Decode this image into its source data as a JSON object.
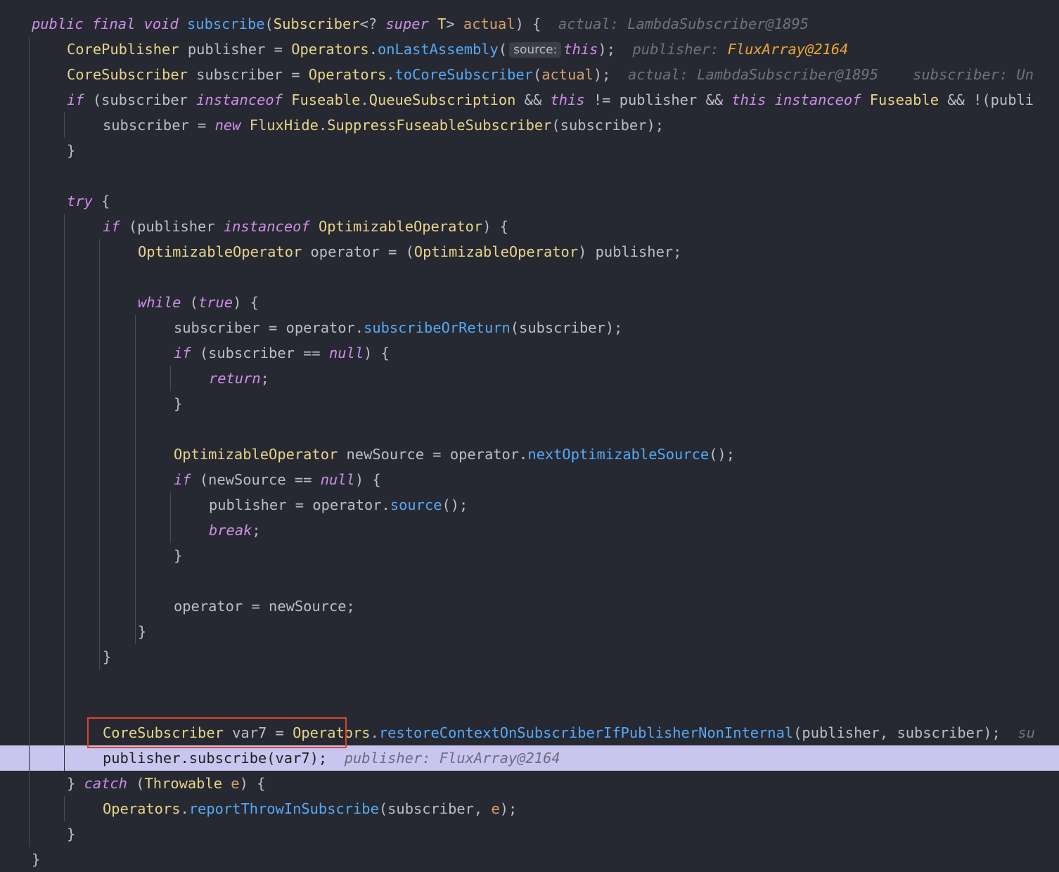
{
  "editor": {
    "highlight_line": 29,
    "lines": [
      {
        "tokens": [
          {
            "t": "public",
            "k": "kw"
          },
          {
            "t": " ",
            "k": "plain"
          },
          {
            "t": "final",
            "k": "kw"
          },
          {
            "t": " ",
            "k": "plain"
          },
          {
            "t": "void",
            "k": "kw"
          },
          {
            "t": " ",
            "k": "plain"
          },
          {
            "t": "subscribe",
            "k": "method"
          },
          {
            "t": "(",
            "k": "plain"
          },
          {
            "t": "Subscriber",
            "k": "type"
          },
          {
            "t": "<? ",
            "k": "plain"
          },
          {
            "t": "super",
            "k": "kw"
          },
          {
            "t": " ",
            "k": "plain"
          },
          {
            "t": "T",
            "k": "type"
          },
          {
            "t": "> ",
            "k": "plain"
          },
          {
            "t": "actual",
            "k": "param"
          },
          {
            "t": ") {  ",
            "k": "plain"
          },
          {
            "t": "actual: LambdaSubscriber@1895",
            "k": "hint"
          }
        ]
      },
      {
        "tokens": [
          {
            "t": "CorePublisher",
            "k": "type"
          },
          {
            "t": " publisher = ",
            "k": "plain"
          },
          {
            "t": "Operators",
            "k": "type"
          },
          {
            "t": ".",
            "k": "plain"
          },
          {
            "t": "onLastAssembly",
            "k": "method"
          },
          {
            "t": "(",
            "k": "plain"
          },
          {
            "t": "source:",
            "k": "paramhint"
          },
          {
            "t": "this",
            "k": "kw"
          },
          {
            "t": ");  ",
            "k": "plain"
          },
          {
            "t": "publisher: ",
            "k": "hint"
          },
          {
            "t": "FluxArray@2164",
            "k": "hintval"
          }
        ]
      },
      {
        "tokens": [
          {
            "t": "CoreSubscriber",
            "k": "type"
          },
          {
            "t": " subscriber = ",
            "k": "plain"
          },
          {
            "t": "Operators",
            "k": "type"
          },
          {
            "t": ".",
            "k": "plain"
          },
          {
            "t": "toCoreSubscriber",
            "k": "method"
          },
          {
            "t": "(",
            "k": "plain"
          },
          {
            "t": "actual",
            "k": "param"
          },
          {
            "t": ");  ",
            "k": "plain"
          },
          {
            "t": "actual: LambdaSubscriber@1895    subscriber: Un",
            "k": "hint"
          }
        ]
      },
      {
        "tokens": [
          {
            "t": "if",
            "k": "kw"
          },
          {
            "t": " (subscriber ",
            "k": "plain"
          },
          {
            "t": "instanceof",
            "k": "kw"
          },
          {
            "t": " ",
            "k": "plain"
          },
          {
            "t": "Fuseable",
            "k": "type"
          },
          {
            "t": ".",
            "k": "plain"
          },
          {
            "t": "QueueSubscription",
            "k": "type"
          },
          {
            "t": " && ",
            "k": "plain"
          },
          {
            "t": "this",
            "k": "kw"
          },
          {
            "t": " != publisher && ",
            "k": "plain"
          },
          {
            "t": "this",
            "k": "kw"
          },
          {
            "t": " ",
            "k": "plain"
          },
          {
            "t": "instanceof",
            "k": "kw"
          },
          {
            "t": " ",
            "k": "plain"
          },
          {
            "t": "Fuseable",
            "k": "type"
          },
          {
            "t": " && !(publi",
            "k": "plain"
          }
        ]
      },
      {
        "tokens": [
          {
            "t": "subscriber = ",
            "k": "plain"
          },
          {
            "t": "new",
            "k": "kw"
          },
          {
            "t": " ",
            "k": "plain"
          },
          {
            "t": "FluxHide",
            "k": "type"
          },
          {
            "t": ".",
            "k": "plain"
          },
          {
            "t": "SuppressFuseableSubscriber",
            "k": "type"
          },
          {
            "t": "(subscriber);",
            "k": "plain"
          }
        ]
      },
      {
        "tokens": [
          {
            "t": "}",
            "k": "plain"
          }
        ]
      },
      {
        "tokens": []
      },
      {
        "tokens": [
          {
            "t": "try",
            "k": "kw"
          },
          {
            "t": " {",
            "k": "plain"
          }
        ]
      },
      {
        "tokens": [
          {
            "t": "if",
            "k": "kw"
          },
          {
            "t": " (publisher ",
            "k": "plain"
          },
          {
            "t": "instanceof",
            "k": "kw"
          },
          {
            "t": " ",
            "k": "plain"
          },
          {
            "t": "OptimizableOperator",
            "k": "type"
          },
          {
            "t": ") {",
            "k": "plain"
          }
        ]
      },
      {
        "tokens": [
          {
            "t": "OptimizableOperator",
            "k": "type"
          },
          {
            "t": " operator = (",
            "k": "plain"
          },
          {
            "t": "OptimizableOperator",
            "k": "type"
          },
          {
            "t": ") publisher;",
            "k": "plain"
          }
        ]
      },
      {
        "tokens": []
      },
      {
        "tokens": [
          {
            "t": "while",
            "k": "kw"
          },
          {
            "t": " (",
            "k": "plain"
          },
          {
            "t": "true",
            "k": "kw"
          },
          {
            "t": ") {",
            "k": "plain"
          }
        ]
      },
      {
        "tokens": [
          {
            "t": "subscriber = operator.",
            "k": "plain"
          },
          {
            "t": "subscribeOrReturn",
            "k": "method"
          },
          {
            "t": "(subscriber);",
            "k": "plain"
          }
        ]
      },
      {
        "tokens": [
          {
            "t": "if",
            "k": "kw"
          },
          {
            "t": " (subscriber == ",
            "k": "plain"
          },
          {
            "t": "null",
            "k": "kw"
          },
          {
            "t": ") {",
            "k": "plain"
          }
        ]
      },
      {
        "tokens": [
          {
            "t": "return",
            "k": "kw"
          },
          {
            "t": ";",
            "k": "plain"
          }
        ]
      },
      {
        "tokens": [
          {
            "t": "}",
            "k": "plain"
          }
        ]
      },
      {
        "tokens": []
      },
      {
        "tokens": [
          {
            "t": "OptimizableOperator",
            "k": "type"
          },
          {
            "t": " newSource = operator.",
            "k": "plain"
          },
          {
            "t": "nextOptimizableSource",
            "k": "method"
          },
          {
            "t": "();",
            "k": "plain"
          }
        ]
      },
      {
        "tokens": [
          {
            "t": "if",
            "k": "kw"
          },
          {
            "t": " (newSource == ",
            "k": "plain"
          },
          {
            "t": "null",
            "k": "kw"
          },
          {
            "t": ") {",
            "k": "plain"
          }
        ]
      },
      {
        "tokens": [
          {
            "t": "publisher = operator.",
            "k": "plain"
          },
          {
            "t": "source",
            "k": "method"
          },
          {
            "t": "();",
            "k": "plain"
          }
        ]
      },
      {
        "tokens": [
          {
            "t": "break",
            "k": "kw"
          },
          {
            "t": ";",
            "k": "plain"
          }
        ]
      },
      {
        "tokens": [
          {
            "t": "}",
            "k": "plain"
          }
        ]
      },
      {
        "tokens": []
      },
      {
        "tokens": [
          {
            "t": "operator = newSource;",
            "k": "plain"
          }
        ]
      },
      {
        "tokens": [
          {
            "t": "}",
            "k": "plain"
          }
        ]
      },
      {
        "tokens": [
          {
            "t": "}",
            "k": "plain"
          }
        ]
      },
      {
        "tokens": []
      },
      {
        "tokens": []
      },
      {
        "tokens": [
          {
            "t": "CoreSubscriber",
            "k": "type"
          },
          {
            "t": " var7 = ",
            "k": "plain"
          },
          {
            "t": "Operators",
            "k": "type"
          },
          {
            "t": ".",
            "k": "plain"
          },
          {
            "t": "restoreContextOnSubscriberIfPublisherNonInternal",
            "k": "method"
          },
          {
            "t": "(publisher, subscriber);  ",
            "k": "plain"
          },
          {
            "t": "su",
            "k": "hint"
          }
        ]
      },
      {
        "tokens": [
          {
            "t": "publisher.subscribe(var7);  ",
            "k": "plain"
          },
          {
            "t": "publisher: FluxArray@2164",
            "k": "hint"
          }
        ]
      },
      {
        "tokens": [
          {
            "t": "} ",
            "k": "plain"
          },
          {
            "t": "catch",
            "k": "kw"
          },
          {
            "t": " (",
            "k": "plain"
          },
          {
            "t": "Throwable",
            "k": "type"
          },
          {
            "t": " ",
            "k": "plain"
          },
          {
            "t": "e",
            "k": "param"
          },
          {
            "t": ") {",
            "k": "plain"
          }
        ]
      },
      {
        "tokens": [
          {
            "t": "Operators",
            "k": "type"
          },
          {
            "t": ".",
            "k": "plain"
          },
          {
            "t": "reportThrowInSubscribe",
            "k": "method"
          },
          {
            "t": "(subscriber, ",
            "k": "plain"
          },
          {
            "t": "e",
            "k": "param"
          },
          {
            "t": ");",
            "k": "plain"
          }
        ]
      },
      {
        "tokens": [
          {
            "t": "}",
            "k": "plain"
          }
        ]
      },
      {
        "tokens": [
          {
            "t": "}",
            "k": "plain"
          }
        ]
      }
    ]
  }
}
